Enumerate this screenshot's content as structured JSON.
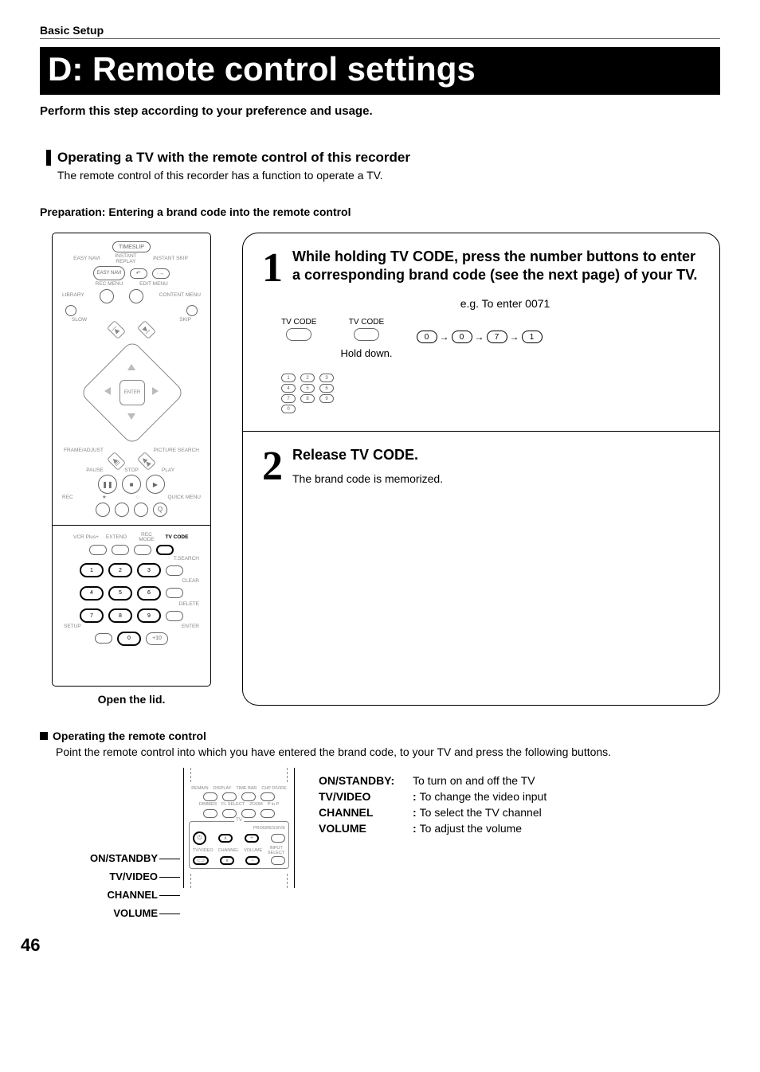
{
  "breadcrumb": "Basic Setup",
  "title": "D: Remote control settings",
  "intro": "Perform this step according to your preference and usage.",
  "section1": {
    "title": "Operating a TV with the remote control of this recorder",
    "desc": "The remote control of this recorder has a function to operate a TV."
  },
  "preparation": "Preparation: Entering a brand code into the remote control",
  "remote": {
    "timeslip": "TIMESLIP",
    "easy_navi": "EASY NAVI",
    "instant_replay": "INSTANT REPLAY",
    "instant_skip": "INSTANT SKIP",
    "rec_menu": "REC MENU",
    "edit_menu": "EDIT MENU",
    "library": "LIBRARY",
    "content_menu": "CONTENT MENU",
    "slow": "SLOW",
    "skip": "SKIP",
    "enter": "ENTER",
    "frame_adjust": "FRAME/ADJUST",
    "picture_search": "PICTURE SEARCH",
    "pause": "PAUSE",
    "stop": "STOP",
    "play": "PLAY",
    "rec": "REC",
    "quick_menu": "QUICK MENU",
    "vcr_plus": "VCR Plus+",
    "extend": "EXTEND",
    "rec_mode": "REC MODE",
    "tv_code": "TV CODE",
    "t_search": "T.SEARCH",
    "clear": "CLEAR",
    "delete": "DELETE",
    "setup": "SETUP",
    "enter2": "ENTER",
    "plus10": "+10",
    "open_lid": "Open the lid."
  },
  "step1": {
    "num": "1",
    "title": "While holding TV CODE, press the number buttons to enter a corresponding brand code (see the next page) of your TV.",
    "example_label": "e.g. To enter 0071",
    "tv_code_label": "TV CODE",
    "hold_down": "Hold down.",
    "code_digits": [
      "0",
      "0",
      "7",
      "1"
    ]
  },
  "step2": {
    "num": "2",
    "title": "Release TV CODE.",
    "body": "The brand code is memorized."
  },
  "section2": {
    "title": "Operating the remote control",
    "desc": "Point the remote control into which you have entered the brand code, to your TV and press the following buttons."
  },
  "callouts": [
    "ON/STANDBY",
    "TV/VIDEO",
    "CHANNEL",
    "VOLUME"
  ],
  "mini_remote": {
    "remain": "REMAIN",
    "display": "DISPLAY",
    "time_bar": "TIME BAR",
    "chp_divide": "CHP DIVIDE",
    "dimmer": "DIMMER",
    "fl_select": "FL SELECT",
    "zoom": "ZOOM",
    "pinp": "P in P",
    "tv": "TV",
    "progressive": "PROGRESSIVE",
    "tv_video": "TV/VIDEO",
    "channel": "CHANNEL",
    "volume": "VOLUME",
    "input_select": "INPUT SELECT"
  },
  "defs": [
    {
      "key": "ON/STANDBY",
      "sep": ":",
      "val": "To turn on and off the TV"
    },
    {
      "key": "TV/VIDEO",
      "sep": ":",
      "val": "To change the video input"
    },
    {
      "key": "CHANNEL",
      "sep": ":",
      "val": "To select the TV channel"
    },
    {
      "key": "VOLUME",
      "sep": ":",
      "val": "To adjust the volume"
    }
  ],
  "page_number": "46"
}
